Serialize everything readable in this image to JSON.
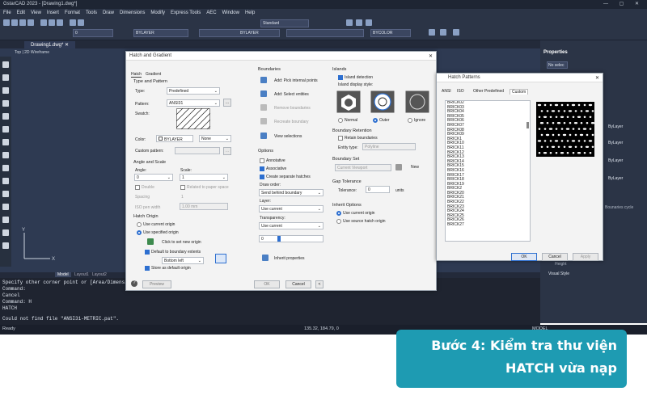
{
  "app": {
    "title": "GstarCAD 2023 - [Drawing1.dwg*]",
    "doc_tab": "Drawing1.dwg*",
    "view_tabs": [
      "Top",
      "2D Wireframe"
    ]
  },
  "menu": [
    "File",
    "Edit",
    "View",
    "Insert",
    "Format",
    "Tools",
    "Draw",
    "Dimensions",
    "Modify",
    "Express Tools",
    "AEC",
    "Window",
    "Help"
  ],
  "toolbar": {
    "style": "Standard",
    "layer": "BYLAYER",
    "linetype": "BYLAYER",
    "color": "BYCOLOR",
    "layer_num": "0"
  },
  "right_panel": {
    "title": "Properties",
    "select": "No selec",
    "items": [
      "ByLayer",
      "ByLayer",
      "ByLayer",
      "ByLayer",
      "Bounaries cycle",
      "Height",
      "Visual Style"
    ]
  },
  "layout_tabs": [
    "Model",
    "Layout1",
    "Layout2"
  ],
  "command": [
    "Specify other corner point or [Area/Dimensions/Rotation]:",
    "Command:",
    "Cancel",
    "Command: H",
    "HATCH",
    "Could not find file \"ANSI31-METRIC.pat\"."
  ],
  "status": {
    "ready": "Ready",
    "coords": "135.32, 184.79, 0",
    "model": "MODEL"
  },
  "hatch": {
    "title": "Hatch and Gradient",
    "tabs": [
      "Hatch",
      "Gradient"
    ],
    "type_pattern": "Type and Pattern",
    "type_label": "Type:",
    "type_value": "Predefined",
    "pattern_label": "Pattern:",
    "pattern_value": "ANSI31",
    "swatch_label": "Swatch:",
    "color_label": "Color:",
    "color_value": "BYLAYER",
    "color2": "None",
    "custom_label": "Custom pattern:",
    "angle_scale": "Angle and Scale",
    "angle_label": "Angle:",
    "angle_value": "0",
    "scale_label": "Scale:",
    "scale_value": "1",
    "double": "Double",
    "relative": "Related to paper space",
    "spacing_label": "Spacing",
    "spacing_value": "1",
    "iso_label": "ISO pen width",
    "iso_value": "1.00 mm",
    "origin": "Hatch Origin",
    "use_current": "Use current origin",
    "use_specified": "Use specified origin",
    "click_set": "Click to set new origin",
    "default_ext": "Default to boundary extents",
    "bottom_left": "Bottom left",
    "store_default": "Store as default origin",
    "preview": "Preview",
    "boundaries": "Boundaries",
    "add_pick": "Add: Pick internal points",
    "add_select": "Add: Select entities",
    "remove_bound": "Remove boundaries",
    "recreate": "Recreate boundary",
    "view_sel": "View selections",
    "options": "Options",
    "annotative": "Annotative",
    "associative": "Associative",
    "separate": "Create separate hatches",
    "draw_order": "Draw order:",
    "draw_order_value": "Send behind boundary",
    "layer": "Layer:",
    "layer_value": "Use current",
    "transparency": "Transparency:",
    "transparency_value": "Use current",
    "transp_num": "0",
    "inherit": "Inherit properties",
    "islands": "Islands",
    "island_detect": "Island detection",
    "island_style": "Island display style:",
    "normal": "Normal",
    "outer": "Outer",
    "ignore": "Ignore",
    "retention": "Boundary Retention",
    "retain": "Retain boundaries",
    "entity_type": "Entity type:",
    "entity_value": "Polyline",
    "bset": "Boundary Set",
    "bset_value": "Current Viewport",
    "new": "New",
    "gap": "Gap Tolerance",
    "tolerance": "Tolerance:",
    "tol_value": "0",
    "units": "units",
    "inherit_opt": "Inherit Options",
    "inh_current": "Use current origin",
    "inh_source": "Use source hatch origin",
    "ok": "OK",
    "cancel": "Cancel"
  },
  "patterns": {
    "title": "Hatch Patterns",
    "tabs": [
      "ANSI",
      "ISO",
      "Other Predefined",
      "Custom"
    ],
    "items": [
      "BRICK02",
      "BRICK03",
      "BRICK04",
      "BRICK05",
      "BRICK06",
      "BRICK07",
      "BRICK08",
      "BRICK09",
      "BRICK1",
      "BRICK10",
      "BRICK11",
      "BRICK12",
      "BRICK13",
      "BRICK14",
      "BRICK15",
      "BRICK16",
      "BRICK17",
      "BRICK18",
      "BRICK19",
      "BRICK2",
      "BRICK20",
      "BRICK21",
      "BRICK22",
      "BRICK23",
      "BRICK24",
      "BRICK25",
      "BRICK26",
      "BRICK27"
    ],
    "ok": "OK",
    "cancel": "Cancel",
    "apply": "Apply"
  },
  "caption": {
    "line1": "Bước 4: Kiểm tra thư viện",
    "line2": "HATCH vừa nạp"
  }
}
